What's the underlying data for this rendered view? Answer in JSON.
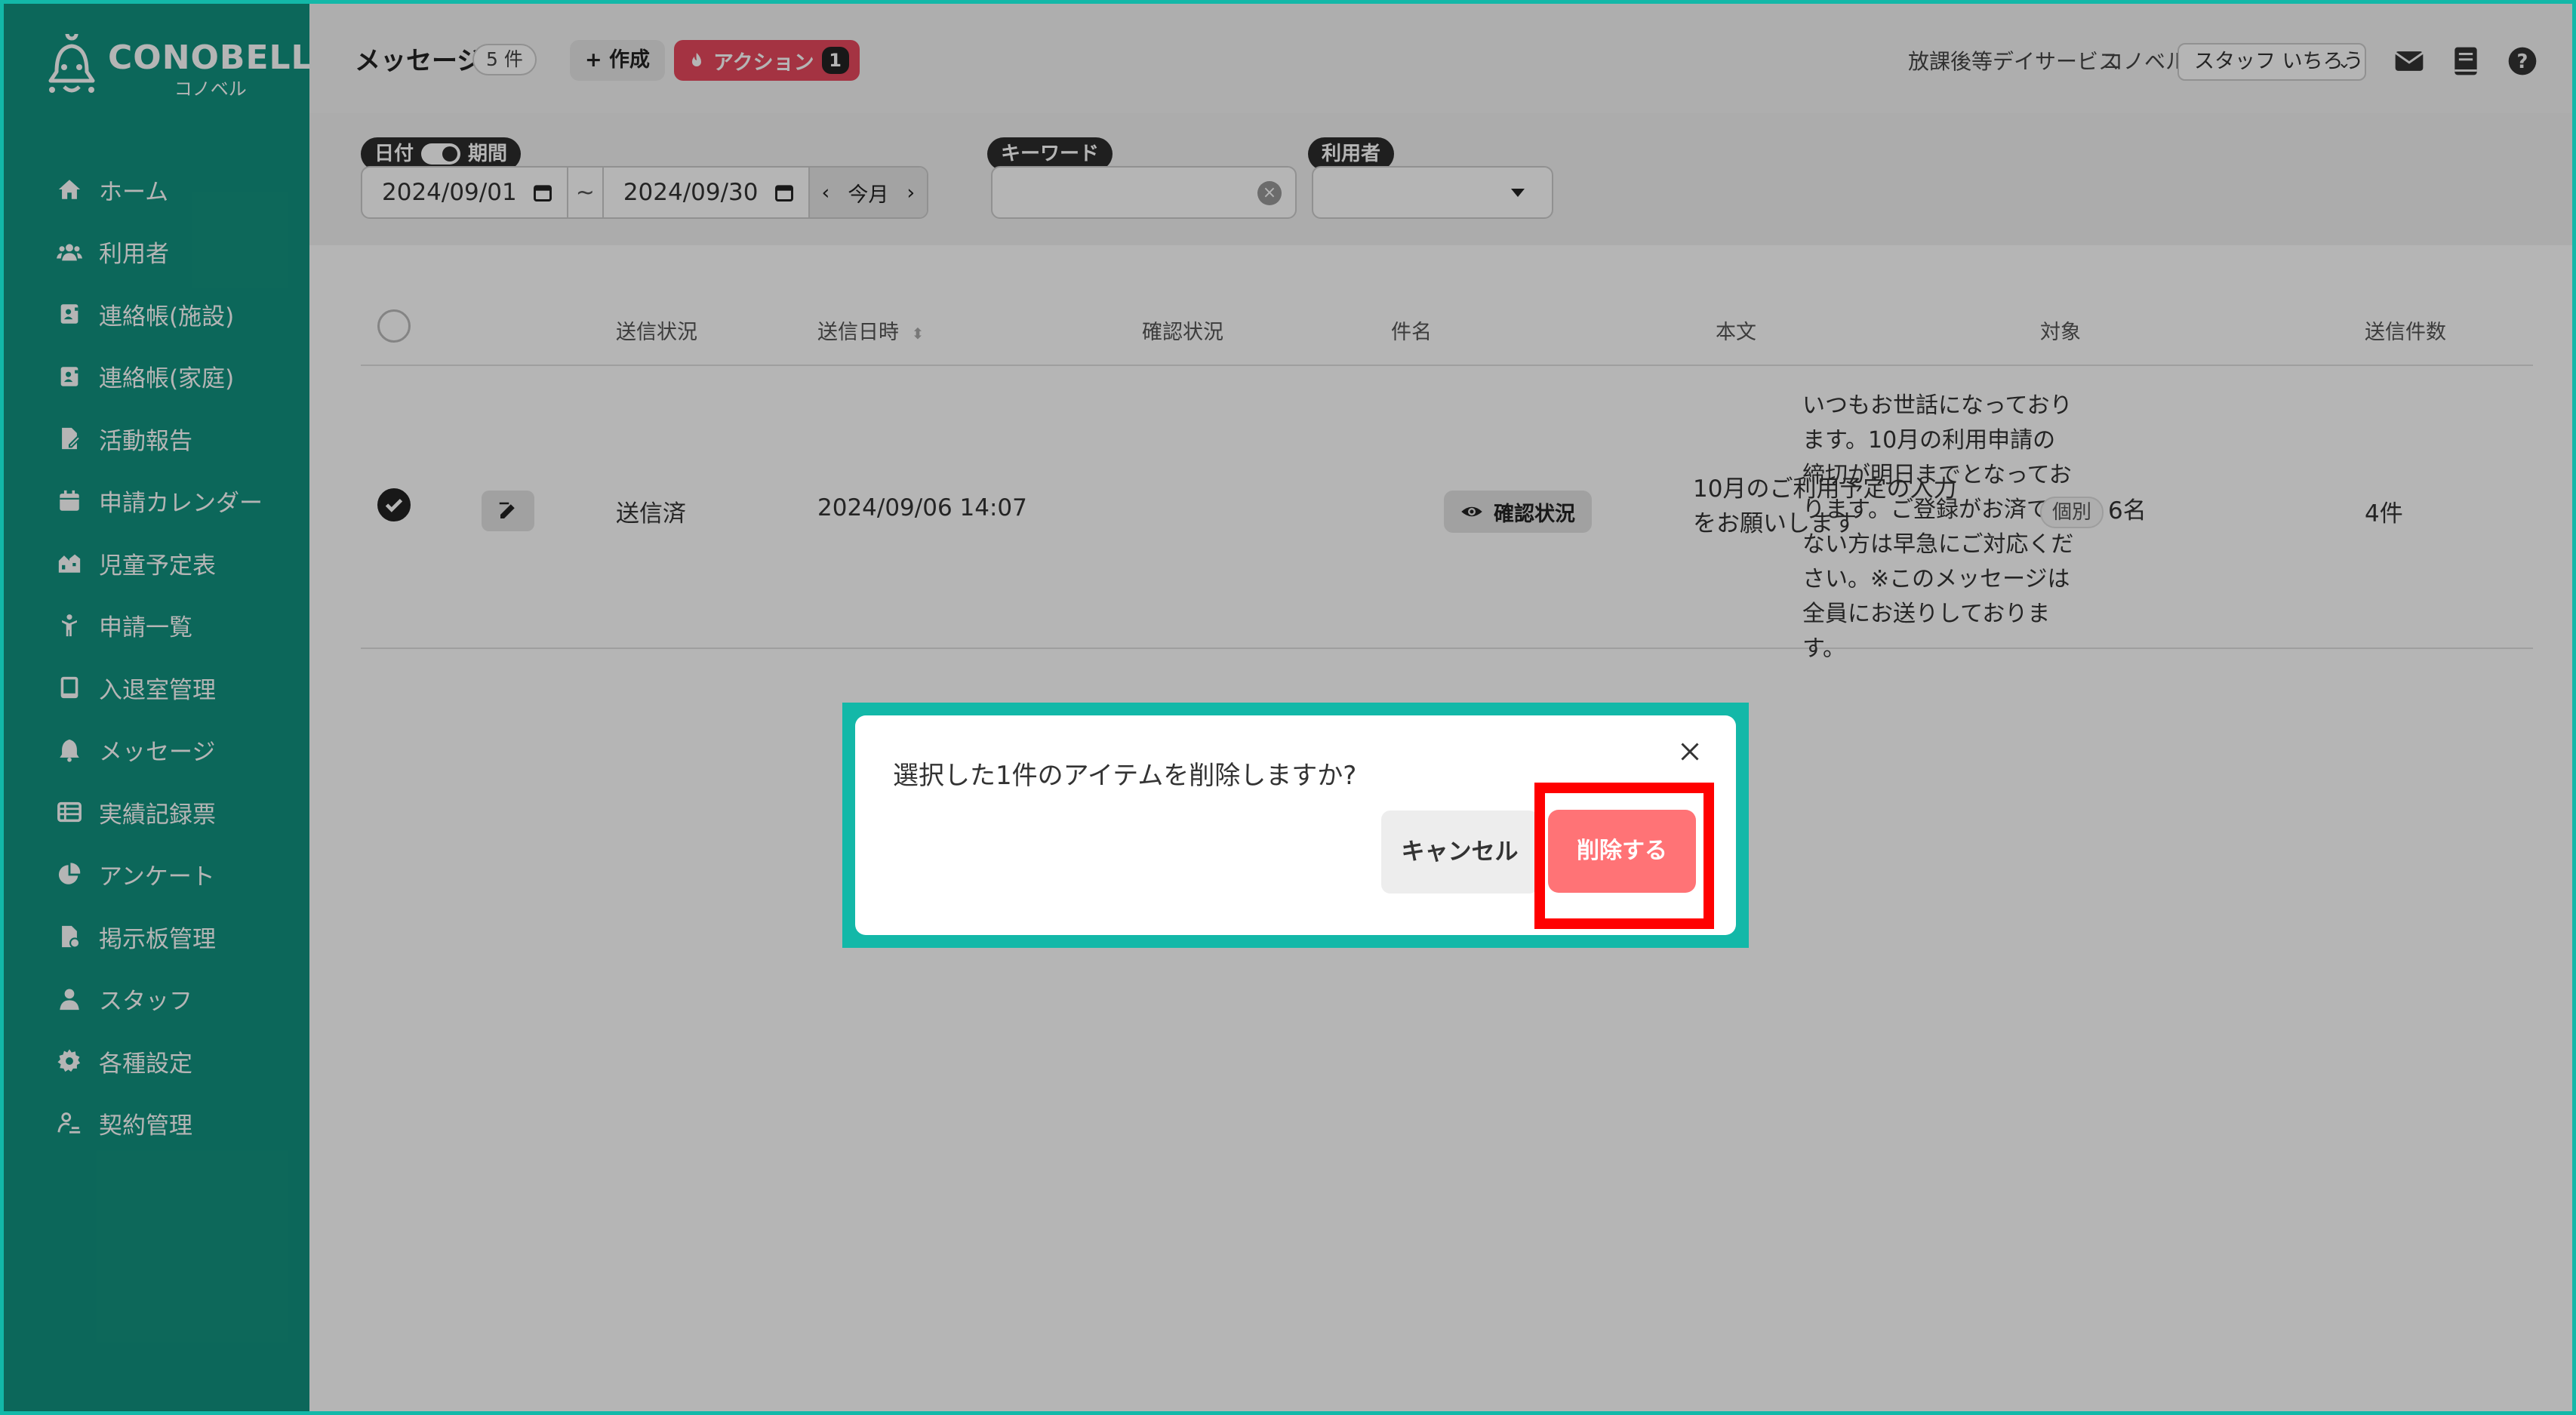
{
  "brand": {
    "name": "CONOBELL",
    "sub": "コノベル"
  },
  "sidebar": {
    "items": [
      {
        "label": "ホーム",
        "icon": "home-icon"
      },
      {
        "label": "利用者",
        "icon": "users-icon"
      },
      {
        "label": "連絡帳(施設)",
        "icon": "contact-book-icon"
      },
      {
        "label": "連絡帳(家庭)",
        "icon": "contact-book-icon"
      },
      {
        "label": "活動報告",
        "icon": "report-icon"
      },
      {
        "label": "申請カレンダー",
        "icon": "calendar-icon"
      },
      {
        "label": "児童予定表",
        "icon": "schedule-icon"
      },
      {
        "label": "申請一覧",
        "icon": "request-icon"
      },
      {
        "label": "入退室管理",
        "icon": "tablet-icon"
      },
      {
        "label": "メッセージ",
        "icon": "bell-icon"
      },
      {
        "label": "実績記録票",
        "icon": "table-icon"
      },
      {
        "label": "アンケート",
        "icon": "pie-chart-icon"
      },
      {
        "label": "掲示板管理",
        "icon": "board-icon"
      },
      {
        "label": "スタッフ",
        "icon": "staff-icon"
      },
      {
        "label": "各種設定",
        "icon": "gear-icon"
      },
      {
        "label": "契約管理",
        "icon": "contract-icon"
      }
    ]
  },
  "header": {
    "title": "メッセージ",
    "count": "5 件",
    "create_label": "作成",
    "action_label": "アクション",
    "action_count": "1",
    "facility": "放課後等デイサービス",
    "org": "コノベル",
    "staff": "スタッフ いちろう"
  },
  "filters": {
    "date_chip": "日付",
    "period_chip": "期間",
    "date_from": "2024/09/01",
    "tilde": "~",
    "date_to": "2024/09/30",
    "this_month": "今月",
    "keyword_chip": "キーワード",
    "user_chip": "利用者"
  },
  "table": {
    "headers": [
      "送信状況",
      "送信日時",
      "確認状況",
      "件名",
      "本文",
      "対象",
      "送信件数"
    ],
    "row": {
      "status": "送信済",
      "datetime": "2024/09/06 14:07",
      "confirm_label": "確認状況",
      "subject": "10月のご利用予定の入力をお願いします",
      "body": "いつもお世話になっております。10月の利用申請の締切が明日までとなっております。ご登録がお済ではない方は早急にご対応ください。※このメッセージは全員にお送りしております。",
      "target_tag": "個別",
      "target_count": "6名",
      "send_count": "4件"
    }
  },
  "dialog": {
    "message": "選択した1件のアイテムを削除しますか?",
    "cancel_label": "キャンセル",
    "delete_label": "削除する"
  },
  "colors": {
    "sidebar": "#12927f",
    "frame": "#13b8a8",
    "action": "#e8485d",
    "delete": "#ff7376",
    "highlight": "#ff0000"
  }
}
